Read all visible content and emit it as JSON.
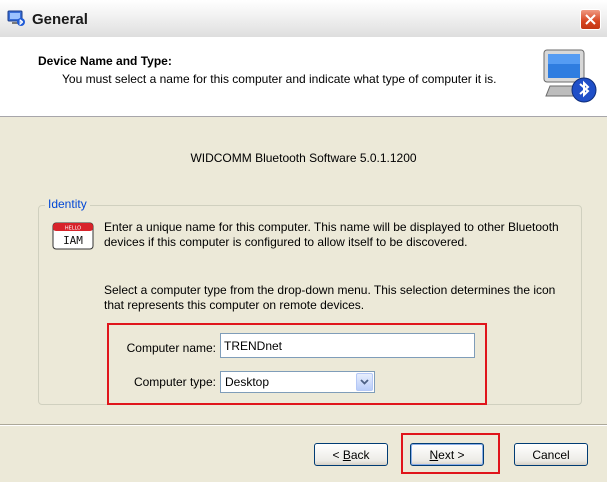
{
  "window": {
    "title": "General",
    "icon": "bluetooth-computer-icon"
  },
  "header": {
    "title": "Device Name and Type:",
    "subtitle": "You must select a name for this computer and indicate what type of computer it is.",
    "icon": "bluetooth-computer-icon"
  },
  "version_text": "WIDCOMM Bluetooth Software 5.0.1.1200",
  "identity": {
    "legend": "Identity",
    "icon": "hello-i-am-badge-icon",
    "name_description": "Enter a unique name for this computer.  This name will be displayed to other Bluetooth devices if this computer is configured to allow itself to be discovered.",
    "type_description": "Select a computer type from the drop-down menu.  This selection determines the icon that represents this computer on remote devices.",
    "computer_name_label": "Computer name:",
    "computer_name_value": "TRENDnet",
    "computer_type_label": "Computer type:",
    "computer_type_value": "Desktop"
  },
  "buttons": {
    "back_prefix": "< ",
    "back_key": "B",
    "back_rest": "ack",
    "next_key": "N",
    "next_rest": "ext >",
    "cancel": "Cancel"
  },
  "colors": {
    "dialog_bg": "#ece9d8",
    "highlight_red": "#e0151b",
    "legend_blue": "#0046d5"
  }
}
